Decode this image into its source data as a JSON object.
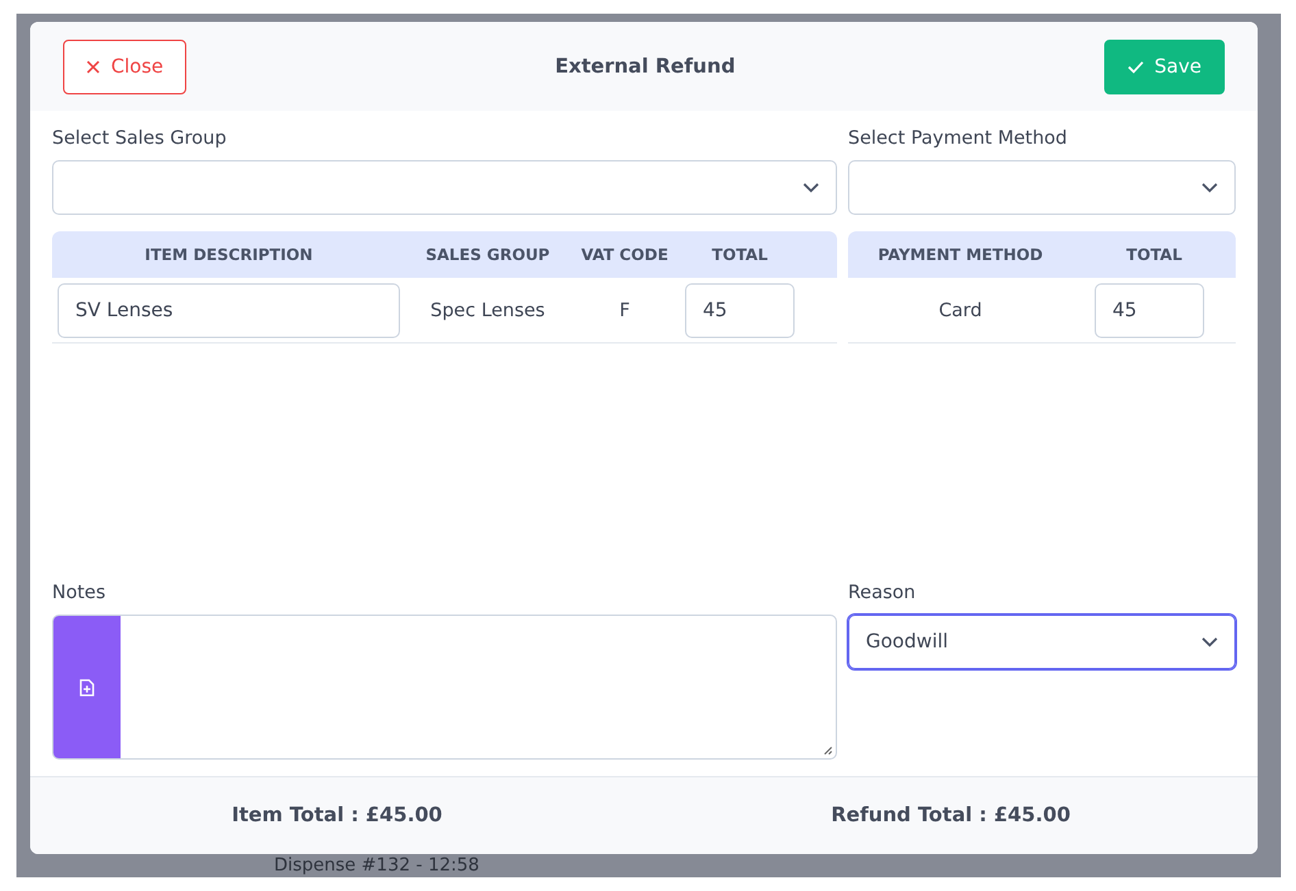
{
  "background": {
    "text": "Dispense #132 - 12:58"
  },
  "dialog": {
    "title": "External Refund",
    "close_button": "Close",
    "save_button": "Save"
  },
  "sales_group": {
    "label": "Select Sales Group"
  },
  "payment_method": {
    "label": "Select Payment Method"
  },
  "items_table": {
    "columns": [
      "ITEM DESCRIPTION",
      "SALES GROUP",
      "VAT CODE",
      "TOTAL"
    ],
    "rows": [
      {
        "description": "SV Lenses",
        "sales_group": "Spec Lenses",
        "vat_code": "F",
        "total": "45"
      }
    ]
  },
  "payments_table": {
    "columns": [
      "PAYMENT METHOD",
      "TOTAL"
    ],
    "rows": [
      {
        "method": "Card",
        "total": "45"
      }
    ]
  },
  "notes": {
    "label": "Notes"
  },
  "reason": {
    "label": "Reason",
    "value": "Goodwill",
    "focused": true
  },
  "footer": {
    "item_total": "Item Total : £45.00",
    "refund_total": "Refund Total : £45.00"
  }
}
